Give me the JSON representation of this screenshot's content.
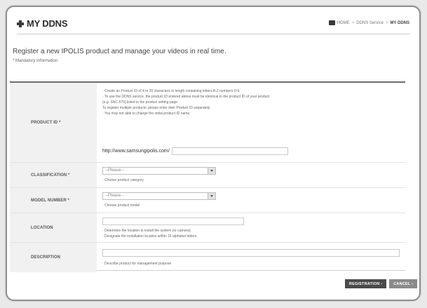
{
  "header": {
    "title": "MY DDNS",
    "breadcrumb": {
      "home": "HOME",
      "section": "DDNS Service",
      "current": "MY DDNS"
    }
  },
  "intro": {
    "heading": "Register a new IPOLIS product and manage your videos in real time.",
    "mandatory": "* Mandatory Information"
  },
  "form": {
    "product_id": {
      "label": "PRODUCT ID *",
      "notes": [
        "· Create an Product ID of 4 to 20 characters in length containing letters A-Z numbers 0-9.",
        "· To use the DDNS service, the product ID entered above must be identical to the product ID of your product",
        "  (e.g. SNC-570) listed in the product setting page.",
        "  To register multiple products, please enter their Product ID separately.",
        "· You may not able to change the initial product ID name."
      ],
      "url_prefix": "http://www.samsungipolis.com/",
      "value": ""
    },
    "classification": {
      "label": "CLASSIFICATION *",
      "selected": "--Please--",
      "hint": "· Choose product category"
    },
    "model_number": {
      "label": "MODEL NUMBER *",
      "selected": "--Please--",
      "hint": "· Choose product model"
    },
    "location": {
      "label": "LOCATION",
      "value": "",
      "notes": [
        "· Determine the location to install the system (or camera).",
        "· Designate the installation location within 16 alphabet letters."
      ]
    },
    "description": {
      "label": "DESCRIPTION",
      "value": "",
      "hint": "· Describe product for management purpose"
    }
  },
  "buttons": {
    "register": "REGISTRATION ›",
    "cancel": "CANCEL ›"
  }
}
